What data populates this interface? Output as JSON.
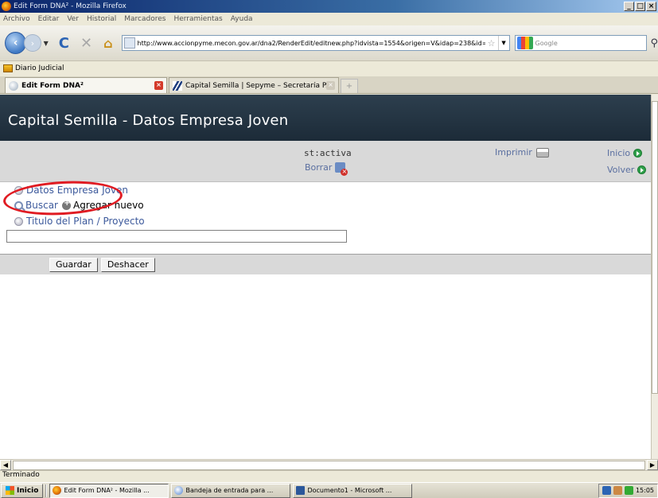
{
  "window": {
    "title": "Edit Form DNA² - Mozilla Firefox",
    "buttons": [
      "_",
      "□",
      "×"
    ]
  },
  "menu": [
    "Archivo",
    "Editar",
    "Ver",
    "Historial",
    "Marcadores",
    "Herramientas",
    "Ayuda"
  ],
  "nav": {
    "url": "http://www.accionpyme.mecon.gov.ar/dna2/RenderEdit/editnew.php?idvista=1554&origen=V&idap=238&id=2",
    "search_placeholder": "Google"
  },
  "bookmarks": [
    "Diario Judicial"
  ],
  "tabs": [
    {
      "label": "Edit Form DNA²",
      "active": true
    },
    {
      "label": "Capital Semilla | Sepyme – Secretaría P...",
      "active": false
    }
  ],
  "page": {
    "header": "Capital Semilla - Datos Empresa Joven",
    "status": "st:activa",
    "borrar": "Borrar",
    "imprimir": "Imprimir",
    "inicio": "Inicio",
    "volver": "Volver",
    "section_label": "Datos Empresa Joven",
    "buscar": "Buscar",
    "agregar": "Agregar nuevo",
    "titulo": "Titulo del Plan / Proyecto",
    "titulo_value": "",
    "guardar": "Guardar",
    "deshacer": "Deshacer"
  },
  "statusbar": "Terminado",
  "taskbar": {
    "start": "Inicio",
    "items": [
      {
        "label": "Edit Form DNA² - Mozilla ...",
        "active": true
      },
      {
        "label": "Bandeja de entrada para ...",
        "active": false
      },
      {
        "label": "Documento1 - Microsoft ...",
        "active": false
      }
    ],
    "clock": "15:05"
  },
  "colors": {
    "header_bg": "#1c2b38",
    "link": "#3d5a9c",
    "annotation": "#e01b22"
  }
}
